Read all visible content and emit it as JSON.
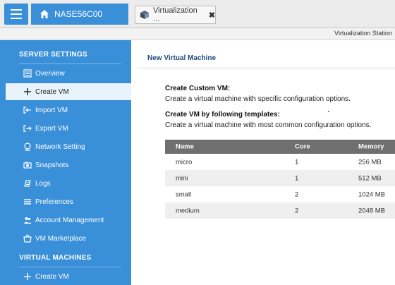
{
  "topbar": {
    "home_tab_label": "NASE56C00",
    "app_tab_label": "Virtualization ...",
    "close_glyph": "✖"
  },
  "subbar": {
    "station_title": "Virtualization Station"
  },
  "sidebar": {
    "server_settings_heading": "SERVER SETTINGS",
    "items": [
      {
        "label": "Overview",
        "icon": "overview-icon"
      },
      {
        "label": "Create VM",
        "icon": "plus-icon",
        "active": true
      },
      {
        "label": "Import VM",
        "icon": "import-icon"
      },
      {
        "label": "Export VM",
        "icon": "export-icon"
      },
      {
        "label": "Network Setting",
        "icon": "network-icon"
      },
      {
        "label": "Snapshots",
        "icon": "snapshot-icon"
      },
      {
        "label": "Logs",
        "icon": "logs-icon"
      },
      {
        "label": "Preferences",
        "icon": "preferences-icon"
      },
      {
        "label": "Account Management",
        "icon": "accounts-icon"
      },
      {
        "label": "VM Marketplace",
        "icon": "marketplace-icon"
      }
    ],
    "virtual_machines_heading": "VIRTUAL MACHINES",
    "vm_create_label": "Create VM"
  },
  "main": {
    "header_title": "New Virtual Machine",
    "custom_title": "Create Custom VM:",
    "custom_desc": "Create a virtual machine with specific configuration options.",
    "template_title": "Create VM by following templates:",
    "template_desc": "Create a virtual machine with most common configuration options.",
    "table": {
      "headers": {
        "name": "Name",
        "core": "Core",
        "memory": "Memory"
      },
      "rows": [
        {
          "name": "micro",
          "core": "1",
          "memory": "256 MB"
        },
        {
          "name": "mini",
          "core": "1",
          "memory": "512 MB"
        },
        {
          "name": "small",
          "core": "2",
          "memory": "1024 MB"
        },
        {
          "name": "medium",
          "core": "2",
          "memory": "2048 MB"
        }
      ]
    }
  },
  "colors": {
    "accent_blue": "#3a8fd9",
    "active_item_bg": "#e9f3fc",
    "table_header": "#6f6f6f"
  }
}
